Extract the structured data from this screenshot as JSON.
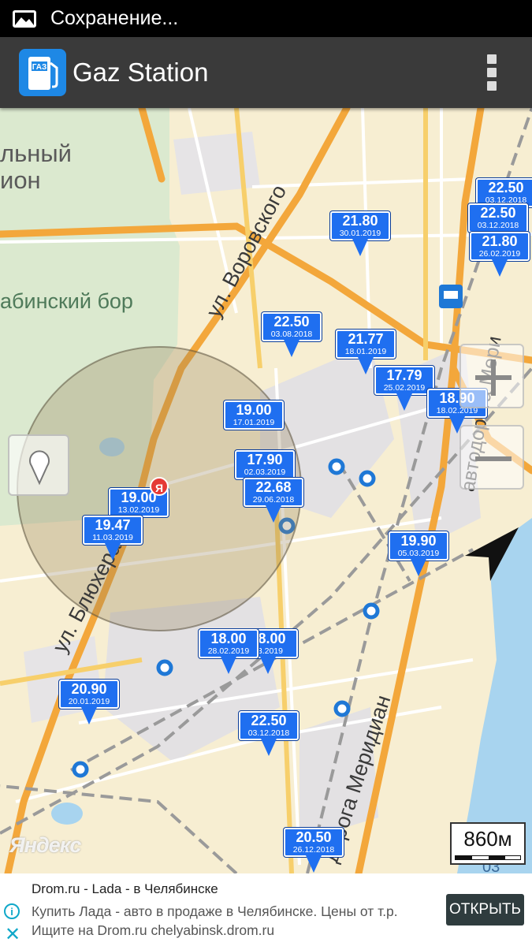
{
  "status_bar": {
    "text": "Сохранение...",
    "icon": "image-icon"
  },
  "app_bar": {
    "title": "Gaz Station",
    "logo_text": "ГАЗ",
    "menu_icon": "overflow-menu-icon"
  },
  "map": {
    "place_labels": [
      "льный",
      "ион",
      "абинский бор"
    ],
    "street_labels": [
      "ул. Воровского",
      "ул. Блюхера",
      "автодорога Меридиан",
      "автодорога Мери",
      "дорога Меридиан",
      "03"
    ],
    "markers": [
      {
        "price": "21.80",
        "date": "30.01.2019"
      },
      {
        "price": "22.50",
        "date": "03.12.2018"
      },
      {
        "price": "22.50",
        "date": "03.12.2018"
      },
      {
        "price": "21.80",
        "date": "26.02.2019"
      },
      {
        "price": "22.50",
        "date": "03.08.2018"
      },
      {
        "price": "21.77",
        "date": "18.01.2019"
      },
      {
        "price": "17.79",
        "date": "25.02.2019"
      },
      {
        "price": "18.90",
        "date": "18.02.2019"
      },
      {
        "price": "19.00",
        "date": "17.01.2019"
      },
      {
        "price": "17.90",
        "date": "02.03.2019"
      },
      {
        "price": "22.68",
        "date": "29.06.2018"
      },
      {
        "price": "19.00",
        "date": "13.02.2019"
      },
      {
        "price": "19.47",
        "date": "11.03.2019"
      },
      {
        "price": "19.90",
        "date": "05.03.2019"
      },
      {
        "price": "18.00",
        "date": "03.2019"
      },
      {
        "price": "18.00",
        "date": "28.02.2019"
      },
      {
        "price": "20.90",
        "date": "20.01.2019"
      },
      {
        "price": "22.50",
        "date": "03.12.2018"
      },
      {
        "price": "20.50",
        "date": "26.12.2018"
      }
    ],
    "controls": {
      "zoom_in": "zoom-in-icon",
      "zoom_out": "zoom-out-icon",
      "locate": "location-pin-icon",
      "compass": "navigation-arrow-icon"
    },
    "scale_label": "860м",
    "attribution": "Яндекс",
    "my_location_badge": "Я"
  },
  "ad": {
    "title": "Drom.ru - Lada - в Челябинске",
    "line1": "Купить Лада - авто в продаже в Челябинске. Цены от т.р.",
    "line2": "Ищите на Drom.ru chelyabinsk.drom.ru",
    "button": "ОТКРЫТЬ"
  }
}
